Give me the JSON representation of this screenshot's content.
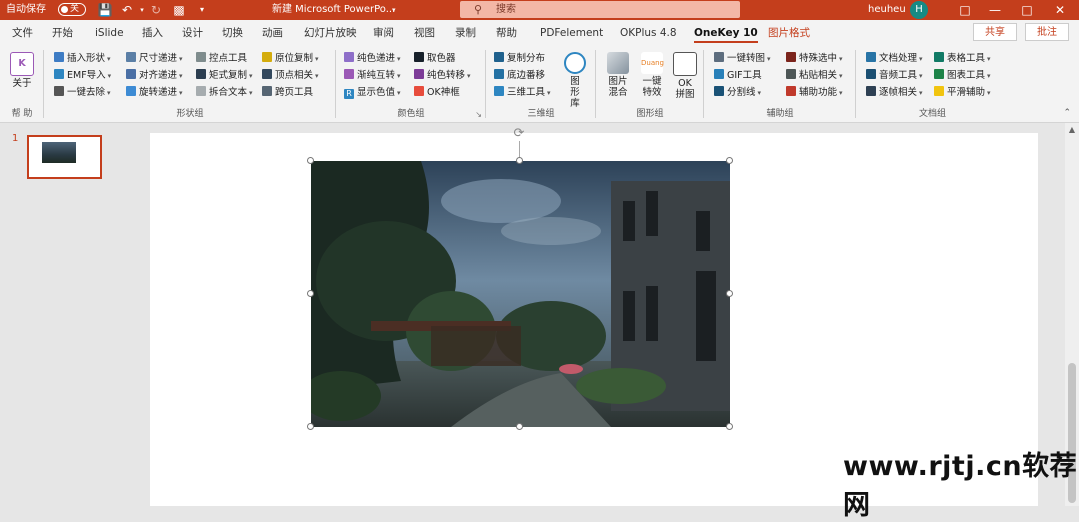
{
  "titlebar": {
    "autosave_label": "自动保存",
    "autosave_state": "关",
    "doc_title": "新建 Microsoft PowerPo...",
    "search_placeholder": "搜索",
    "user_name": "heuheu",
    "user_initial": "H",
    "accent_color": "#c43e1c"
  },
  "menubar": {
    "tabs": [
      "文件",
      "开始",
      "iSlide",
      "插入",
      "设计",
      "切换",
      "动画",
      "幻灯片放映",
      "审阅",
      "视图",
      "录制",
      "帮助",
      "PDFelement",
      "OKPlus 4.8",
      "OneKey 10",
      "图片格式"
    ],
    "active_tab": "OneKey 10",
    "share_label": "共享",
    "comment_label": "批注"
  },
  "ribbon": {
    "help": {
      "button": "关于",
      "label": "帮 助"
    },
    "shape": {
      "label": "形状组",
      "items": [
        "插入形状",
        "EMF导入",
        "一键去除",
        "尺寸递进",
        "对齐递进",
        "旋转递进",
        "控点工具",
        "矩式复制",
        "拆合文本",
        "原位复制",
        "顶点相关",
        "跨页工具"
      ]
    },
    "color": {
      "label": "颜色组",
      "items": [
        "纯色递进",
        "渐纯互转",
        "显示色值",
        "取色器",
        "纯色转移",
        "OK神框"
      ]
    },
    "threed": {
      "label": "三维组",
      "items": [
        "复制分布",
        "底边番移",
        "三维工具"
      ],
      "big": "图形库"
    },
    "image": {
      "label": "图形组",
      "buttons": [
        "图片混合",
        "一键特效",
        "OK拼图"
      ],
      "badge": "Duang"
    },
    "assist": {
      "label": "辅助组",
      "items": [
        "一键转图",
        "GIF工具",
        "分割线",
        "特殊选中",
        "粘贴相关",
        "辅助功能"
      ]
    },
    "doc": {
      "label": "文档组",
      "items": [
        "文档处理",
        "音频工具",
        "逐帧相关",
        "表格工具",
        "图表工具",
        "平滑辅助"
      ]
    }
  },
  "slides": {
    "current_number": "1"
  },
  "watermark": "www.rjtj.cn软荐网"
}
